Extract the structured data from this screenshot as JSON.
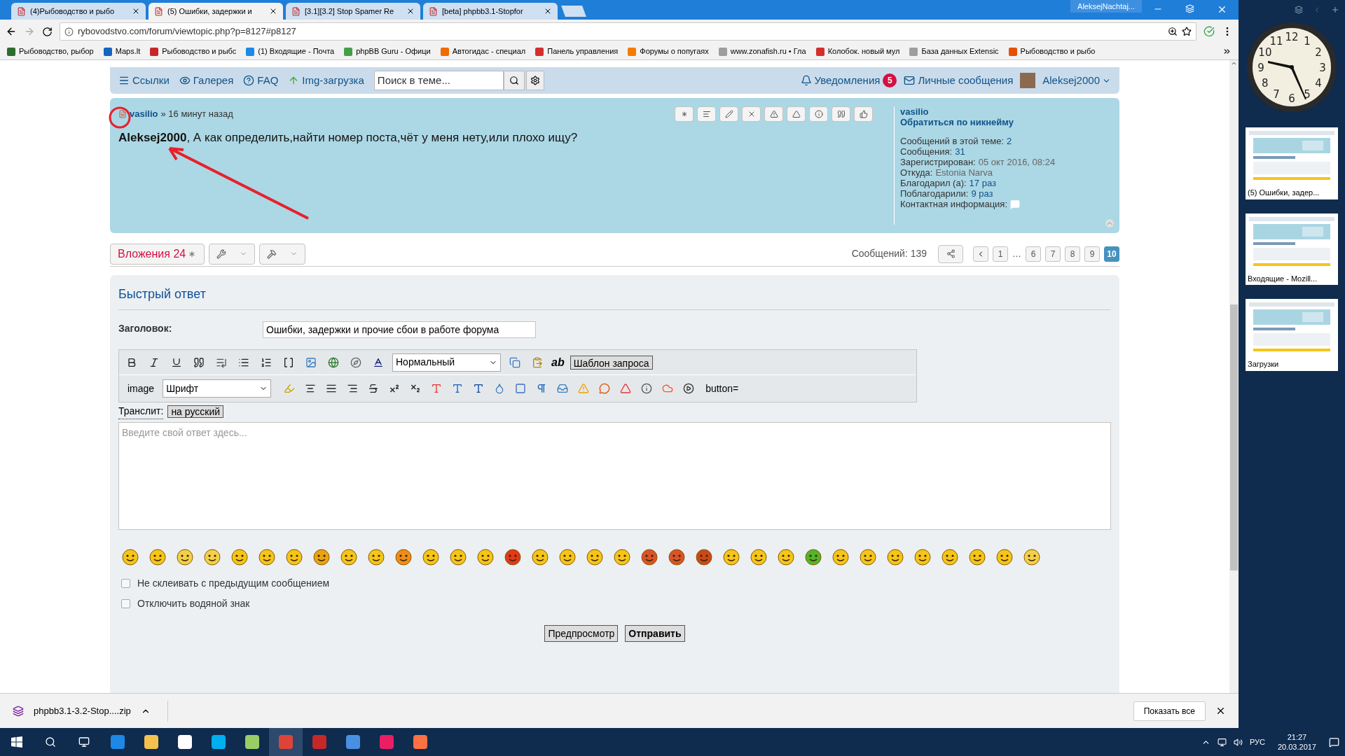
{
  "browser": {
    "tabs": [
      {
        "title": "(4)Рыбоводство и рыбо",
        "selected": false
      },
      {
        "title": "(5) Ошибки, задержки и",
        "selected": true
      },
      {
        "title": "[3.1][3.2] Stop Spamer Re",
        "selected": false
      },
      {
        "title": "[beta] phpbb3.1-Stopfor",
        "selected": false
      }
    ],
    "profile": "AleksejNachtaj...",
    "url": "rybovodstvo.com/forum/viewtopic.php?p=8127#p8127",
    "bookmarks": [
      "Рыбоводство, рыбор",
      "Maps.lt",
      "Рыбоводство и рыбс",
      "(1) Входящие - Почта",
      "phpBB Guru - Офици",
      "Автогидас - специал",
      "Панель управления",
      "Форумы о попугаях",
      "www.zonafish.ru • Гла",
      "Колобок. новый мул",
      "База данных Extensic",
      "Рыбоводство и рыбо"
    ]
  },
  "forum_nav": {
    "items": [
      "Ссылки",
      "Галерея",
      "FAQ",
      "Img-загрузка"
    ],
    "search": {
      "placeholder": "Поиск в теме..."
    },
    "notifications": "Уведомления",
    "notification_count": "5",
    "messages": "Личные сообщения",
    "user": "Aleksej2000"
  },
  "post": {
    "author": "vasilio",
    "time": "» 16 минут назад",
    "text": "**Aleksej2000**, А как определить,найти номер поста,чёт у меня нету,или плохо ищу?",
    "profile": {
      "name": "vasilio",
      "mention_link": "Обратиться по никнейму",
      "fields": [
        {
          "label": "Сообщений в этой теме:",
          "value": "2",
          "kind": "link"
        },
        {
          "label": "Сообщения:",
          "value": "31",
          "kind": "link"
        },
        {
          "label": "Зарегистрирован:",
          "value": "05 окт 2016, 08:24",
          "kind": "plain"
        },
        {
          "label": "Откуда:",
          "value": "Estonia Narva",
          "kind": "plain"
        },
        {
          "label": "Благодарил (а):",
          "value": "17 раз",
          "kind": "link"
        },
        {
          "label": "Поблагодарили:",
          "value": "9 раз",
          "kind": "link"
        },
        {
          "label": "Контактная информация:",
          "kind": "contact"
        }
      ]
    }
  },
  "topic_bar": {
    "attachments": "Вложения 24",
    "posts_count": "Сообщений: 139",
    "pages": [
      {
        "label": "1",
        "selected": false
      },
      {
        "label": "…",
        "kind": "gap"
      },
      {
        "label": "6",
        "selected": false
      },
      {
        "label": "7",
        "selected": false
      },
      {
        "label": "8",
        "selected": false
      },
      {
        "label": "9",
        "selected": false
      },
      {
        "label": "10",
        "selected": true
      }
    ]
  },
  "quick_reply": {
    "title": "Быстрый ответ",
    "subject_label": "Заголовок:",
    "subject": "Ошибки, задержки и прочие сбои в работе форума",
    "size_select": "Нормальный",
    "ab": "ab",
    "template_button": "Шаблон запроса",
    "image_label": "image",
    "font_select": "Шрифт",
    "button_label": "button=",
    "translit_label": "Транслит:",
    "translit_button": "на русский",
    "placeholder": "Введите свой ответ здесь...",
    "options": [
      {
        "label": "Не склеивать с предыдущим сообщением",
        "checked": false
      },
      {
        "label": "Отключить водяной знак",
        "checked": false
      }
    ],
    "preview": "Предпросмотр",
    "submit": "Отправить"
  },
  "download_bar": {
    "file": "phpbb3.1-3.2-Stop....zip",
    "show_all": "Показать все"
  },
  "gadgets": {
    "clock_numerals": [
      "11",
      "12",
      "1",
      "10",
      "2",
      "9",
      "3",
      "8",
      "4",
      "7",
      "5",
      "6"
    ],
    "thumbnails": [
      "(5) Ошибки, задер...",
      "Входящие - Mozill...",
      "Загрузки"
    ]
  },
  "taskbar": {
    "language": "РУС",
    "time": "21:27",
    "date": "20.03.2017"
  }
}
